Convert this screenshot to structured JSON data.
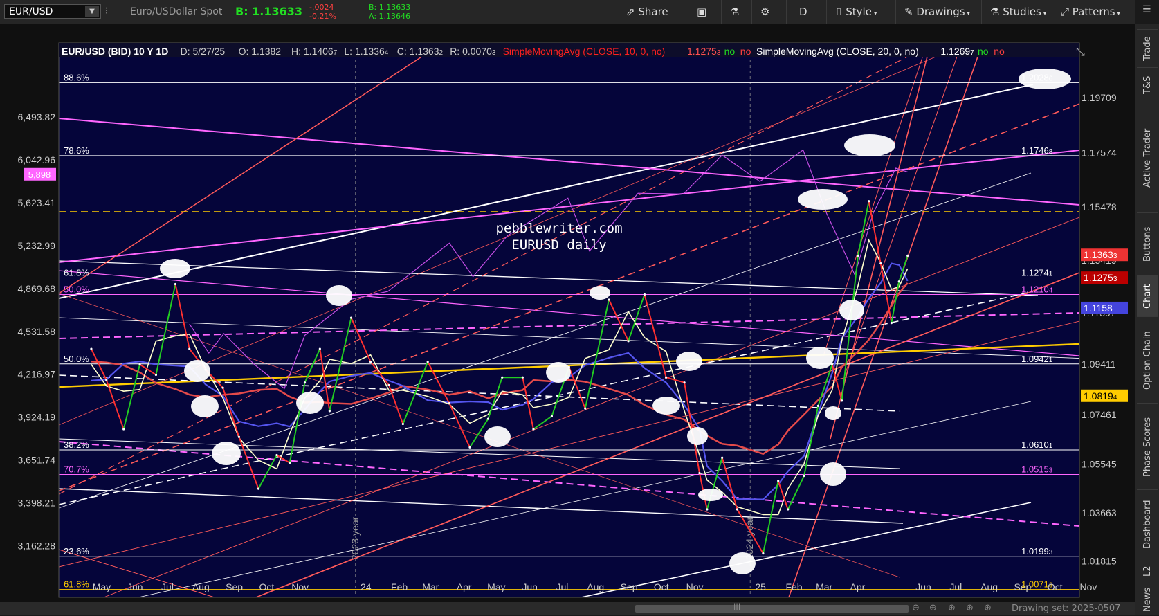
{
  "toolbar": {
    "symbol": "EUR/USD",
    "description": "Euro/USDollar Spot",
    "bid_price": "B: 1.13633",
    "change": "-.0024",
    "change_pct": "-0.21%",
    "bid_small": "B: 1.13633",
    "ask_small": "A: 1.13646",
    "buttons": {
      "share": "Share",
      "period": "D",
      "style": "Style",
      "drawings": "Drawings",
      "studies": "Studies",
      "patterns": "Patterns"
    }
  },
  "sidebar": {
    "tabs": [
      "Trade",
      "T&S",
      "Active Trader",
      "Buttons",
      "Chart",
      "Option Chain",
      "Phase Scores",
      "Dashboard",
      "L2",
      "News"
    ]
  },
  "footer": {
    "drawing_set": "Drawing set: 2025-0507"
  },
  "colors": {
    "bg": "#05053a",
    "up": "#22cc22",
    "down": "#ff3030",
    "fib_white": "#ffffff",
    "fib_pink": "#ff66ff",
    "sma10": "#ff2020",
    "yellow": "#ffcc00"
  },
  "chart_data": {
    "type": "line",
    "title": "EUR/USD (BID) 10 Y 1D",
    "ohlc_header": {
      "date": "D: 5/27/25",
      "open": "O: 1.1382",
      "high": "H: 1.1406",
      "high_sub": "7",
      "low": "L: 1.1336",
      "low_sub": "4",
      "close": "C: 1.1363",
      "close_sub": "2",
      "range": "R: 0.0070",
      "range_sub": "3"
    },
    "studies": [
      {
        "label": "SimpleMovingAvg (CLOSE, 10, 0, no)",
        "value": "1.1275",
        "value_sub": "3",
        "flag1": "no",
        "flag2": "no",
        "color": "#ff2020"
      },
      {
        "label": "SimpleMovingAvg (CLOSE, 20, 0, no)",
        "value": "1.1269",
        "value_sub": "7",
        "flag1": "no",
        "flag2": "no",
        "color": "#ffffff"
      }
    ],
    "watermark": [
      "pebblewriter.com",
      "EURUSD daily"
    ],
    "x_ticks": [
      "May",
      "Jun",
      "Jul",
      "Aug",
      "Sep",
      "Oct",
      "Nov",
      "24",
      "Feb",
      "Mar",
      "Apr",
      "May",
      "Jun",
      "Jul",
      "Aug",
      "Sep",
      "Oct",
      "Nov",
      "25",
      "Feb",
      "Mar",
      "Apr",
      "Jun",
      "Jul",
      "Aug",
      "Sep",
      "Oct",
      "Nov"
    ],
    "year_marks": [
      "2023 year",
      "2024 year"
    ],
    "right_axis": {
      "ticks": [
        "1.19709",
        "1.17574",
        "1.15478",
        "1.13419",
        "1.11397",
        "1.09411",
        "1.07461",
        "1.05545",
        "1.03663",
        "1.01815"
      ]
    },
    "right_badges": [
      {
        "label": "1.1363",
        "sub": "3",
        "bg": "#e33"
      },
      {
        "label": "1.1275",
        "sub": "3",
        "bg": "#b00"
      },
      {
        "label": "1.1158",
        "sub": "",
        "bg": "#4444dd"
      },
      {
        "label": "1.0819",
        "sub": "4",
        "bg": "#ffcc00"
      }
    ],
    "left_axis": {
      "ticks": [
        "6,493.82",
        "6,042.96",
        "5,623.41",
        "5,232.99",
        "4,869.68",
        "4,531.58",
        "4,216.97",
        "3,924.19",
        "3,651.74",
        "3,398.21",
        "3,162.28"
      ],
      "badge": "5,898"
    },
    "fib_levels": [
      {
        "pct": "88.6%",
        "price": "1.2028",
        "sub": "6",
        "color": "#ffffff"
      },
      {
        "pct": "78.6%",
        "price": "1.1746",
        "sub": "8",
        "color": "#ffffff"
      },
      {
        "pct": "61.8%",
        "price": "1.1274",
        "sub": "1",
        "color": "#ffffff"
      },
      {
        "pct": "50.0%",
        "price": "1.1210",
        "sub": "4",
        "color": "#ff66ff"
      },
      {
        "pct": "50.0%",
        "price": "1.0942",
        "sub": "1",
        "color": "#ffffff"
      },
      {
        "pct": "38.2%",
        "price": "1.0610",
        "sub": "1",
        "color": "#ffffff"
      },
      {
        "pct": "70.7%",
        "price": "1.0515",
        "sub": "3",
        "color": "#ff66ff"
      },
      {
        "pct": "23.6%",
        "price": "1.0199",
        "sub": "3",
        "color": "#ffffff"
      },
      {
        "pct": "61.8%",
        "price": "1.0071",
        "sub": "3",
        "color": "#ffcc00"
      }
    ],
    "series": [
      {
        "name": "EUR/USD",
        "points": [
          [
            "2023-05-01",
            1.1
          ],
          [
            "2023-05-15",
            1.088
          ],
          [
            "2023-05-31",
            1.069
          ],
          [
            "2023-06-15",
            1.094
          ],
          [
            "2023-06-30",
            1.09
          ],
          [
            "2023-07-18",
            1.125
          ],
          [
            "2023-07-31",
            1.1
          ],
          [
            "2023-08-15",
            1.092
          ],
          [
            "2023-08-31",
            1.085
          ],
          [
            "2023-09-15",
            1.066
          ],
          [
            "2023-10-03",
            1.046
          ],
          [
            "2023-10-20",
            1.059
          ],
          [
            "2023-11-01",
            1.056
          ],
          [
            "2023-11-15",
            1.087
          ],
          [
            "2023-11-29",
            1.1
          ],
          [
            "2023-12-08",
            1.076
          ],
          [
            "2023-12-28",
            1.112
          ],
          [
            "2024-01-15",
            1.095
          ],
          [
            "2024-02-01",
            1.086
          ],
          [
            "2024-02-14",
            1.071
          ],
          [
            "2024-03-08",
            1.095
          ],
          [
            "2024-03-28",
            1.079
          ],
          [
            "2024-04-16",
            1.062
          ],
          [
            "2024-05-03",
            1.073
          ],
          [
            "2024-05-16",
            1.089
          ],
          [
            "2024-06-04",
            1.089
          ],
          [
            "2024-06-14",
            1.069
          ],
          [
            "2024-07-01",
            1.074
          ],
          [
            "2024-07-17",
            1.093
          ],
          [
            "2024-08-01",
            1.077
          ],
          [
            "2024-08-23",
            1.119
          ],
          [
            "2024-09-10",
            1.103
          ],
          [
            "2024-09-25",
            1.121
          ],
          [
            "2024-10-15",
            1.089
          ],
          [
            "2024-11-01",
            1.087
          ],
          [
            "2024-11-15",
            1.052
          ],
          [
            "2024-11-22",
            1.038
          ],
          [
            "2024-12-06",
            1.058
          ],
          [
            "2024-12-20",
            1.038
          ],
          [
            "2025-01-13",
            1.021
          ],
          [
            "2025-01-27",
            1.049
          ],
          [
            "2025-02-05",
            1.038
          ],
          [
            "2025-02-20",
            1.051
          ],
          [
            "2025-03-05",
            1.078
          ],
          [
            "2025-03-18",
            1.094
          ],
          [
            "2025-03-27",
            1.08
          ],
          [
            "2025-04-11",
            1.136
          ],
          [
            "2025-04-21",
            1.157
          ],
          [
            "2025-05-02",
            1.133
          ],
          [
            "2025-05-12",
            1.11
          ],
          [
            "2025-05-19",
            1.126
          ],
          [
            "2025-05-27",
            1.136
          ]
        ]
      },
      {
        "name": "SPX",
        "points": [
          [
            "2023-07-31",
            4588
          ],
          [
            "2023-08-18",
            4370
          ],
          [
            "2023-09-01",
            4515
          ],
          [
            "2023-09-29",
            4288
          ],
          [
            "2023-10-27",
            4117
          ],
          [
            "2023-11-15",
            4502
          ],
          [
            "2023-12-28",
            4783
          ],
          [
            "2024-01-31",
            4845
          ],
          [
            "2024-03-28",
            5254
          ],
          [
            "2024-04-19",
            4967
          ],
          [
            "2024-05-21",
            5321
          ],
          [
            "2024-07-16",
            5667
          ],
          [
            "2024-08-05",
            5186
          ],
          [
            "2024-09-19",
            5713
          ],
          [
            "2024-10-31",
            5705
          ],
          [
            "2024-12-06",
            6090
          ],
          [
            "2025-01-10",
            5827
          ],
          [
            "2025-02-19",
            6144
          ],
          [
            "2025-03-13",
            5521
          ],
          [
            "2025-04-08",
            4982
          ],
          [
            "2025-04-25",
            5525
          ],
          [
            "2025-05-16",
            5958
          ],
          [
            "2025-05-27",
            5921
          ]
        ]
      }
    ]
  }
}
